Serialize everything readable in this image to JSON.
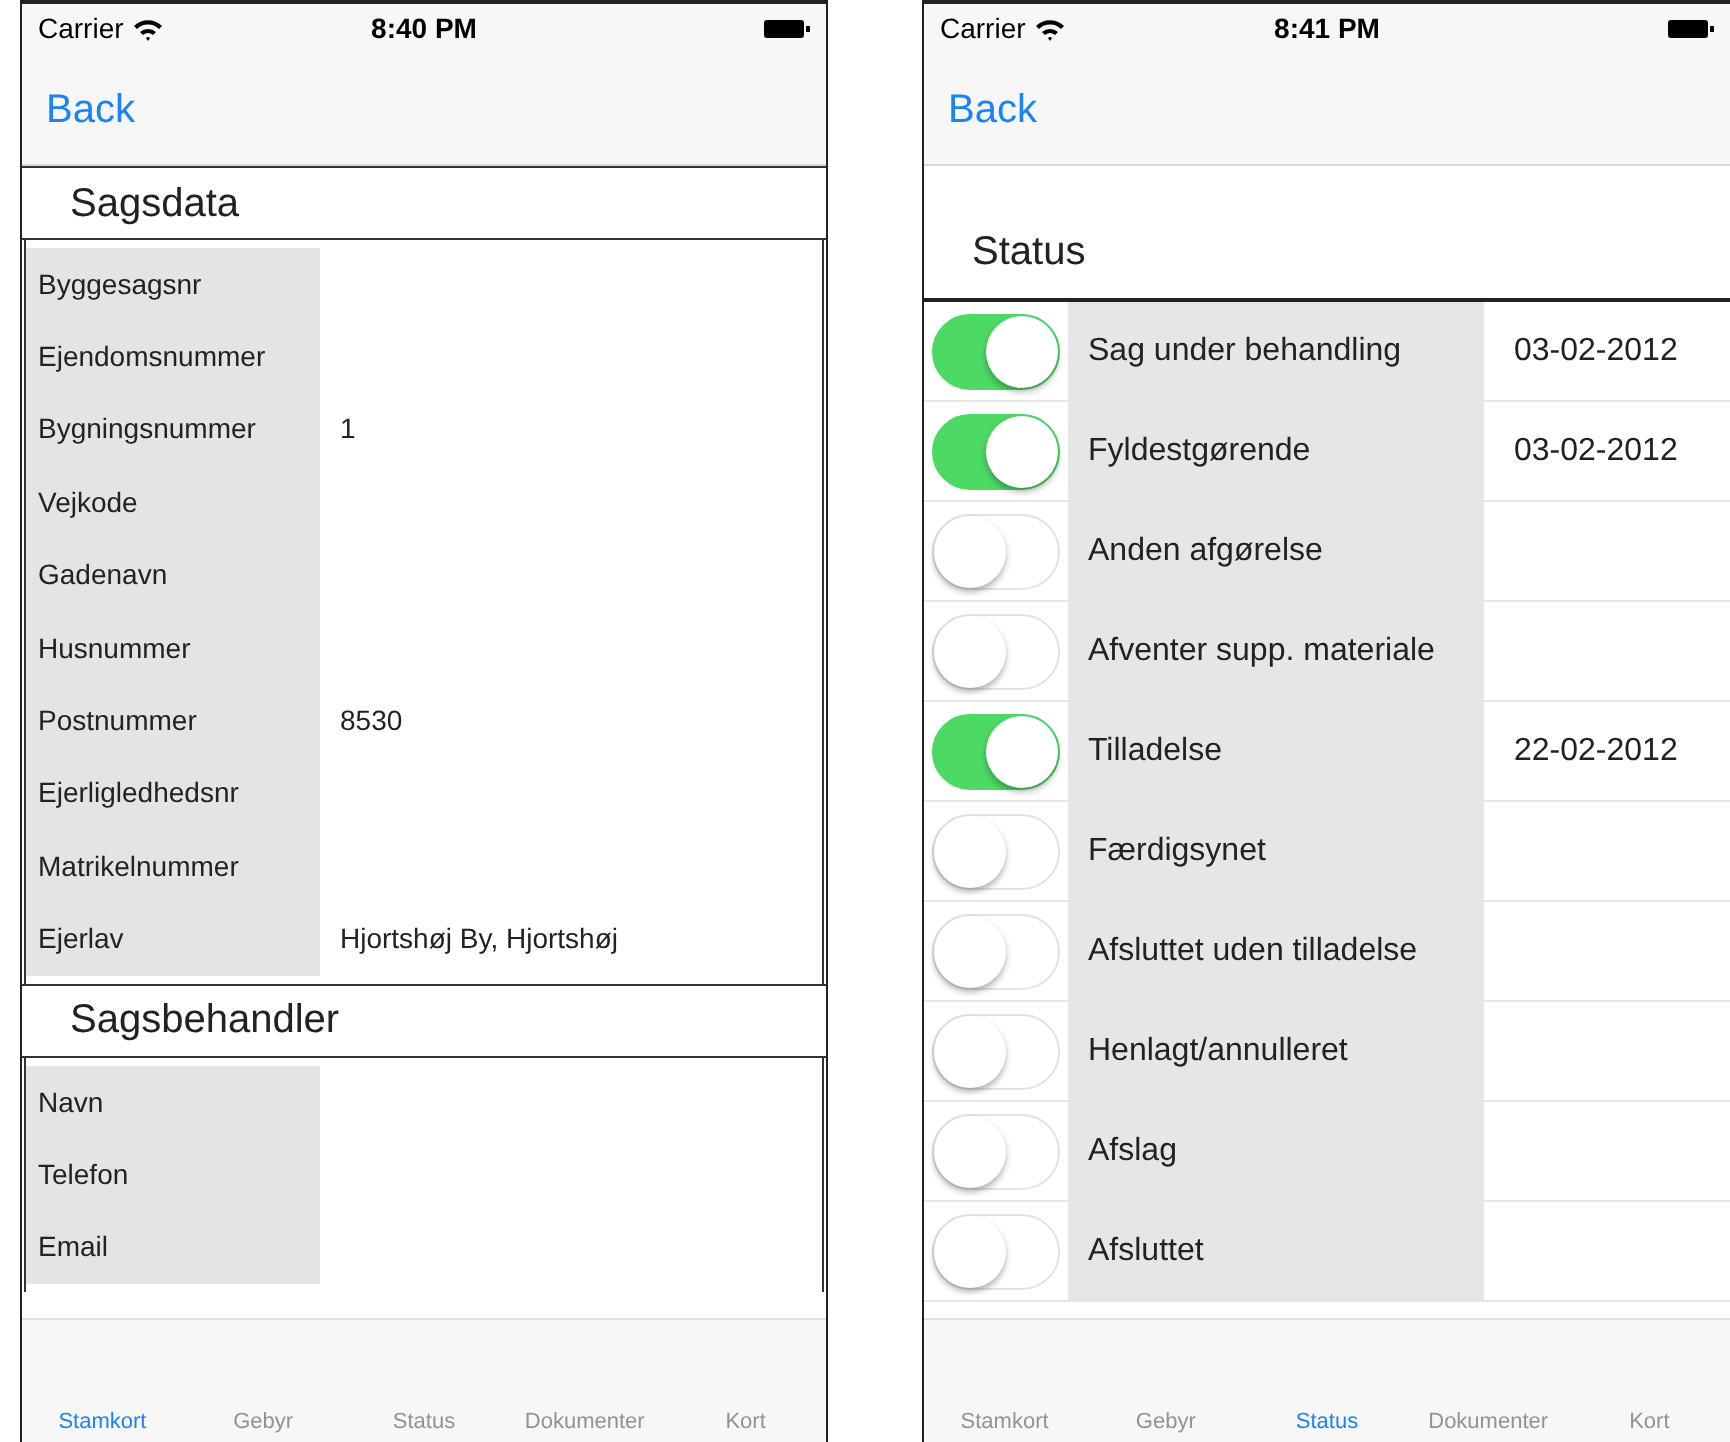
{
  "screens": [
    {
      "kind": "form",
      "status_bar": {
        "carrier": "Carrier",
        "time": "8:40 PM"
      },
      "nav": {
        "back": "Back"
      },
      "sections": [
        {
          "title": "Sagsdata",
          "rows": [
            {
              "label": "Byggesagsnr"
            },
            {
              "label": "Ejendomsnummer"
            },
            {
              "label": "Bygningsnummer",
              "value": "1"
            },
            {
              "label": "Vejkode"
            },
            {
              "label": "Gadenavn"
            },
            {
              "label": "Husnummer"
            },
            {
              "label": "Postnummer",
              "value": "8530"
            },
            {
              "label": "Ejerligledhedsnr"
            },
            {
              "label": "Matrikelnummer"
            },
            {
              "label": "Ejerlav",
              "value": "Hjortshøj By, Hjortshøj"
            }
          ]
        },
        {
          "title": "Sagsbehandler",
          "rows": [
            {
              "label": "Navn"
            },
            {
              "label": "Telefon"
            },
            {
              "label": "Email"
            }
          ]
        }
      ],
      "tabs": [
        {
          "label": "Stamkort",
          "selected": true
        },
        {
          "label": "Gebyr",
          "selected": false
        },
        {
          "label": "Status",
          "selected": false
        },
        {
          "label": "Dokumenter",
          "selected": false
        },
        {
          "label": "Kort",
          "selected": false
        }
      ]
    },
    {
      "kind": "status",
      "status_bar": {
        "carrier": "Carrier",
        "time": "8:41 PM"
      },
      "nav": {
        "back": "Back"
      },
      "status_title": "Status",
      "items": [
        {
          "label": "Sag under behandling",
          "on": true,
          "date": "03-02-2012"
        },
        {
          "label": "Fyldestgørende",
          "on": true,
          "date": "03-02-2012"
        },
        {
          "label": "Anden afgørelse",
          "on": false
        },
        {
          "label": "Afventer supp. materiale",
          "on": false
        },
        {
          "label": "Tilladelse",
          "on": true,
          "date": "22-02-2012"
        },
        {
          "label": "Færdigsynet",
          "on": false
        },
        {
          "label": "Afsluttet uden tilladelse",
          "on": false
        },
        {
          "label": "Henlagt/annulleret",
          "on": false
        },
        {
          "label": "Afslag",
          "on": false
        },
        {
          "label": "Afsluttet",
          "on": false
        }
      ],
      "tabs": [
        {
          "label": "Stamkort",
          "selected": false
        },
        {
          "label": "Gebyr",
          "selected": false
        },
        {
          "label": "Status",
          "selected": true
        },
        {
          "label": "Dokumenter",
          "selected": false
        },
        {
          "label": "Kort",
          "selected": false
        }
      ]
    }
  ]
}
